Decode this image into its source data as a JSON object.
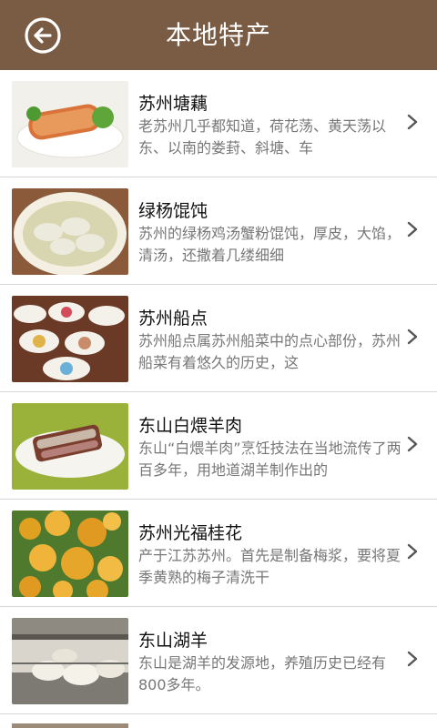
{
  "header": {
    "title": "本地特产",
    "back_icon": "back-arrow-circle-icon"
  },
  "items": [
    {
      "title": "苏州塘藕",
      "desc": "老苏州几乎都知道，荷花荡、黄天荡以东、以南的娄葑、斜塘、车"
    },
    {
      "title": "绿杨馄饨",
      "desc": "苏州的绿杨鸡汤蟹粉馄饨，厚皮，大馅，清汤，还撒着几缕细细"
    },
    {
      "title": "苏州船点",
      "desc": "苏州船点属苏州船菜中的点心部份，苏州船菜有着悠久的历史，这"
    },
    {
      "title": "东山白煨羊肉",
      "desc": "东山“白煨羊肉”烹饪技法在当地流传了两百多年，用地道湖羊制作出的"
    },
    {
      "title": "苏州光福桂花",
      "desc": "产于江苏苏州。首先是制备梅浆，要将夏季黄熟的梅子清洗干"
    },
    {
      "title": "东山湖羊",
      "desc": "东山是湖羊的发源地，养殖历史已经有800多年。"
    }
  ],
  "colors": {
    "header_bg": "#7a5c45",
    "title_text": "#ffffff",
    "item_title": "#111111",
    "item_desc": "#777777",
    "divider": "#d7d7d7"
  }
}
